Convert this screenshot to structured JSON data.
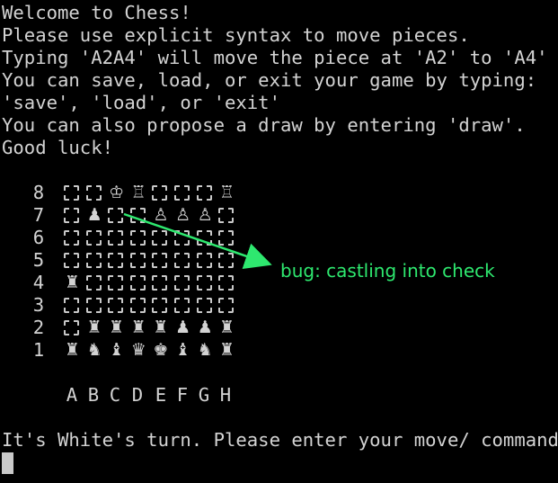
{
  "terminal": {
    "intro_lines": [
      "Welcome to Chess!",
      "Please use explicit syntax to move pieces.",
      "Typing 'A2A4' will move the piece at 'A2' to 'A4'",
      "You can save, load, or exit your game by typing:",
      "'save', 'load', or 'exit'",
      "You can also propose a draw by entering 'draw'.",
      "Good luck!"
    ],
    "prompt_line": "It's White's turn. Please enter your move/ command."
  },
  "board": {
    "ranks": [
      "8",
      "7",
      "6",
      "5",
      "4",
      "3",
      "2",
      "1"
    ],
    "files": [
      "A",
      "B",
      "C",
      "D",
      "E",
      "F",
      "G",
      "H"
    ],
    "rows": [
      [
        "",
        "",
        "♔",
        "♖",
        "",
        "",
        "",
        "♖"
      ],
      [
        "",
        "♟",
        "",
        "",
        "♙",
        "♙",
        "♙",
        ""
      ],
      [
        "",
        "",
        "",
        "",
        "",
        "",
        "",
        ""
      ],
      [
        "",
        "",
        "",
        "",
        "",
        "",
        "",
        ""
      ],
      [
        "♜",
        "",
        "",
        "",
        "",
        "",
        "",
        ""
      ],
      [
        "",
        "",
        "",
        "",
        "",
        "",
        "",
        ""
      ],
      [
        "",
        "♜",
        "♜",
        "♜",
        "♜",
        "♟",
        "♟",
        "♜"
      ],
      [
        "♜",
        "♞",
        "♝",
        "♛",
        "♚",
        "♝",
        "♞",
        "♜"
      ]
    ]
  },
  "annotation": {
    "text": "bug: castling into check",
    "color": "#2ee86f"
  }
}
